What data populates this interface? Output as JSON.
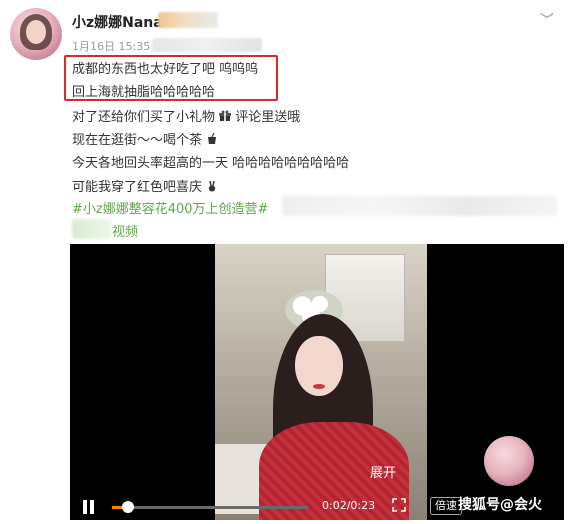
{
  "post": {
    "username": "小z娜娜Nana",
    "timestamp": "1月16日 15:35 来",
    "lines": [
      "成都的东西也太好吃了吧 呜呜呜",
      "回上海就抽脂哈哈哈哈哈",
      "对了还给你们买了小礼物",
      "评论里送哦",
      "现在在逛街～～喝个茶",
      "今天各地回头率超高的一天 哈哈哈哈哈哈哈哈哈",
      "可能我穿了红色吧喜庆",
      "#小z娜娜整容花400万上创造营#",
      "视频"
    ]
  },
  "video": {
    "expand_label": "展开",
    "time": "0:02/0:23",
    "speed_label": "倍速",
    "progress": 0.08,
    "watermark": "搜狐号@会火"
  },
  "colors": {
    "highlight_border": "#e02727",
    "topic_green": "#62a34b",
    "progress_orange": "#ff8200"
  },
  "icons": [
    "chevron-down-icon",
    "gift-icon",
    "tea-icon",
    "victory-hand-icon",
    "pause-icon",
    "fullscreen-icon"
  ]
}
